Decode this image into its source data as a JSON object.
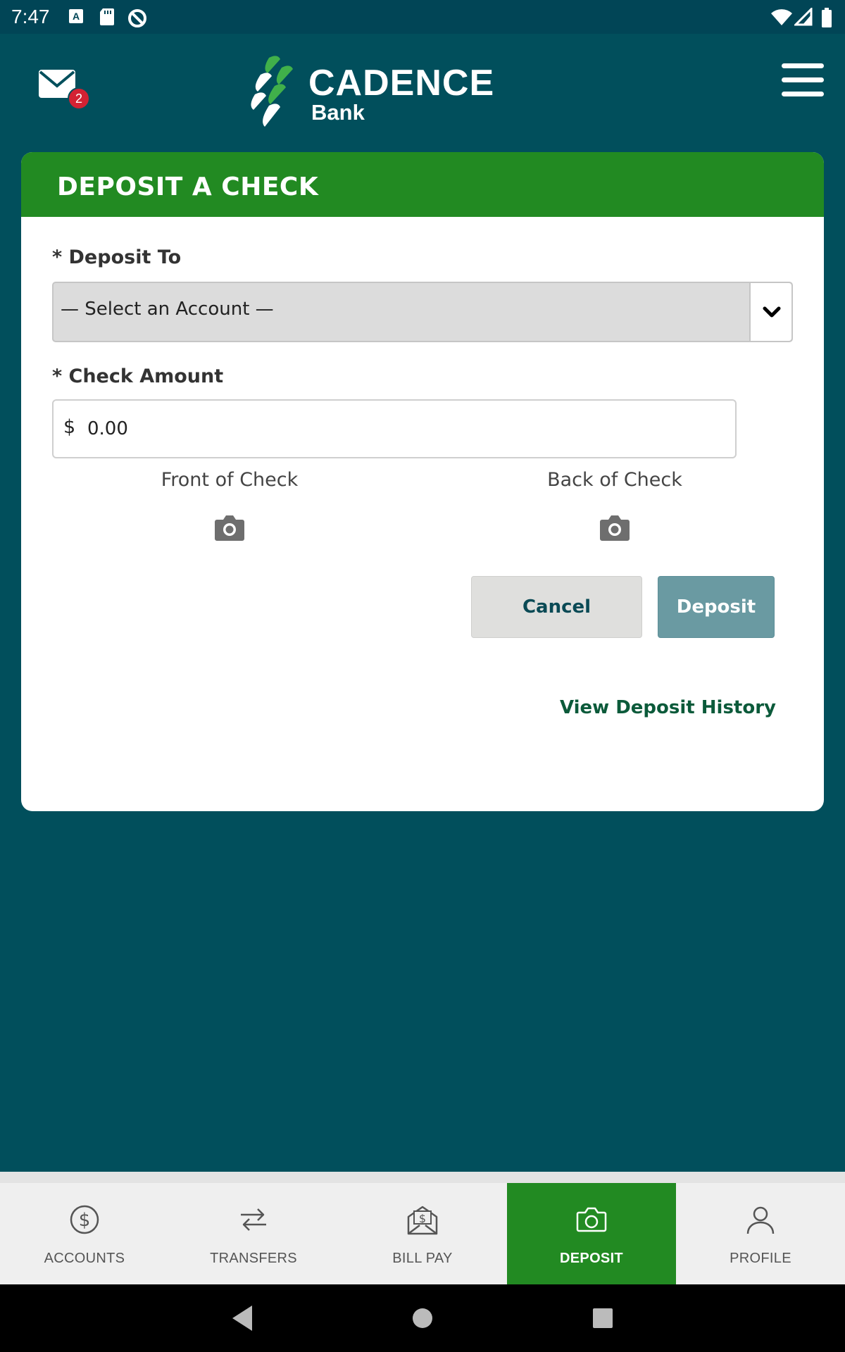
{
  "status_bar": {
    "time": "7:47",
    "icons": [
      "a-keyboard-icon",
      "sd-card-icon",
      "data-saver-icon",
      "wifi-icon",
      "signal-icon",
      "battery-icon"
    ]
  },
  "header": {
    "mail_badge_count": "2",
    "logo_name": "CADENCE",
    "logo_sub": "Bank"
  },
  "card": {
    "title": "DEPOSIT A CHECK",
    "deposit_to_label": "* Deposit To",
    "select_placeholder": "— Select an Account —",
    "check_amount_label": "* Check Amount",
    "currency_symbol": "$",
    "amount_value": "0.00",
    "front_label": "Front of Check",
    "back_label": "Back of Check",
    "cancel_label": "Cancel",
    "deposit_label": "Deposit",
    "history_link": "View Deposit History"
  },
  "tabs": [
    {
      "label": "ACCOUNTS",
      "icon": "dollar-circle-icon",
      "active": false
    },
    {
      "label": "TRANSFERS",
      "icon": "transfer-arrows-icon",
      "active": false
    },
    {
      "label": "BILL PAY",
      "icon": "bill-envelope-icon",
      "active": false
    },
    {
      "label": "DEPOSIT",
      "icon": "camera-icon",
      "active": true
    },
    {
      "label": "PROFILE",
      "icon": "person-icon",
      "active": false
    }
  ],
  "colors": {
    "background": "#014f5c",
    "brand_green": "#228a22",
    "deposit_button": "#6a9aa2",
    "badge_red": "#d32233"
  }
}
